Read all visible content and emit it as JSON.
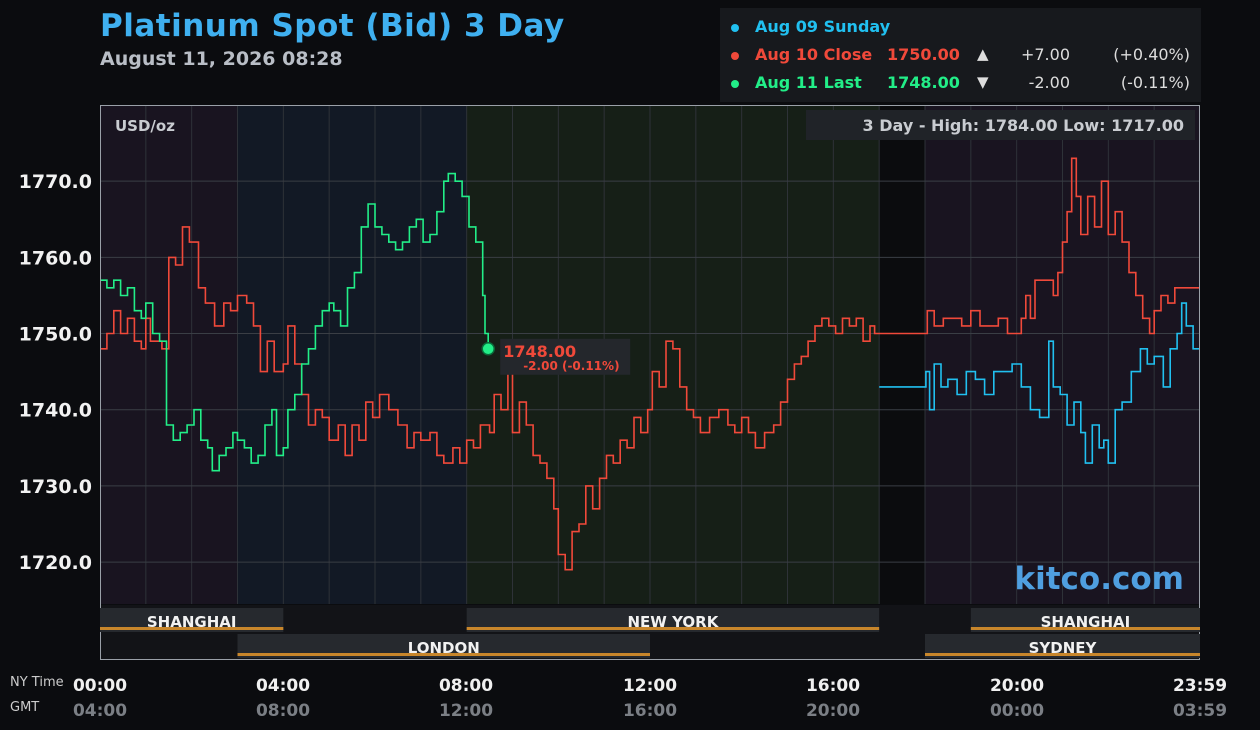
{
  "header": {
    "title": "Platinum Spot (Bid) 3 Day",
    "subtitle": "August 11, 2026 08:28"
  },
  "legend": [
    {
      "label": "Aug 09 Sunday",
      "value": "",
      "arrow": "",
      "change": "",
      "pct": "",
      "color": "#21c0f0"
    },
    {
      "label": "Aug 10 Close",
      "value": "1750.00",
      "arrow": "▲",
      "change": "+7.00",
      "pct": "(+0.40%)",
      "color": "#f0493a"
    },
    {
      "label": "Aug 11 Last",
      "value": "1748.00",
      "arrow": "▼",
      "change": "-2.00",
      "pct": "(-0.11%)",
      "color": "#22ee88"
    }
  ],
  "axis_labels": {
    "ny_time": "NY Time",
    "gmt": "GMT"
  },
  "ny_ticks": [
    "00:00",
    "04:00",
    "08:00",
    "12:00",
    "16:00",
    "20:00",
    "23:59"
  ],
  "gmt_ticks": [
    "04:00",
    "08:00",
    "12:00",
    "16:00",
    "20:00",
    "00:00",
    "03:59"
  ],
  "chart_data": {
    "type": "line",
    "unit_label": "USD/oz",
    "high_low_label": "3 Day - High: 1784.00  Low: 1717.00",
    "watermark": "kitco.com",
    "last_label": {
      "price": "1748.00",
      "change": "-2.00 (-0.11%)",
      "x": 8.47,
      "y": 1748
    },
    "x_unit": "hours (NY time)",
    "xlim": [
      0,
      24
    ],
    "ylim": [
      1714.5,
      1780.0
    ],
    "yticks": [
      1720.0,
      1730.0,
      1740.0,
      1750.0,
      1760.0,
      1770.0
    ],
    "ytick_labels": [
      "1720.0",
      "1730.0",
      "1740.0",
      "1750.0",
      "1760.0",
      "1770.0"
    ],
    "grid": true,
    "sessions": [
      {
        "name": "SHANGHAI",
        "start": 0,
        "end": 4,
        "row": 1
      },
      {
        "name": "NEW YORK",
        "start": 8,
        "end": 17,
        "row": 1
      },
      {
        "name": "SHANGHAI",
        "start": 19,
        "end": 24,
        "row": 1
      },
      {
        "name": "LONDON",
        "start": 3,
        "end": 12,
        "row": 2
      },
      {
        "name": "SYDNEY",
        "start": 18,
        "end": 24,
        "row": 2
      }
    ],
    "series": [
      {
        "name": "Aug 09 Sunday",
        "color": "#21c0f0",
        "points": [
          [
            17.0,
            1743
          ],
          [
            18.0,
            1743
          ],
          [
            18.02,
            1745
          ],
          [
            18.1,
            1740
          ],
          [
            18.2,
            1746
          ],
          [
            18.35,
            1743
          ],
          [
            18.5,
            1744
          ],
          [
            18.7,
            1742
          ],
          [
            18.9,
            1745
          ],
          [
            19.1,
            1744
          ],
          [
            19.3,
            1742
          ],
          [
            19.5,
            1745
          ],
          [
            19.7,
            1745
          ],
          [
            19.9,
            1746
          ],
          [
            20.1,
            1743
          ],
          [
            20.3,
            1740
          ],
          [
            20.5,
            1739
          ],
          [
            20.7,
            1749
          ],
          [
            20.8,
            1743
          ],
          [
            20.95,
            1742
          ],
          [
            21.1,
            1738
          ],
          [
            21.25,
            1741
          ],
          [
            21.4,
            1737
          ],
          [
            21.5,
            1733
          ],
          [
            21.65,
            1738
          ],
          [
            21.8,
            1735
          ],
          [
            21.9,
            1736
          ],
          [
            22.0,
            1733
          ],
          [
            22.15,
            1740
          ],
          [
            22.3,
            1741
          ],
          [
            22.5,
            1745
          ],
          [
            22.7,
            1748
          ],
          [
            22.85,
            1746
          ],
          [
            23.0,
            1747
          ],
          [
            23.2,
            1743
          ],
          [
            23.35,
            1748
          ],
          [
            23.5,
            1750
          ],
          [
            23.6,
            1754
          ],
          [
            23.7,
            1751
          ],
          [
            23.85,
            1748
          ],
          [
            24.0,
            1748
          ]
        ]
      },
      {
        "name": "Aug 10 Close",
        "color": "#f0493a",
        "points": [
          [
            0.0,
            1748
          ],
          [
            0.15,
            1750
          ],
          [
            0.3,
            1753
          ],
          [
            0.45,
            1750
          ],
          [
            0.6,
            1752
          ],
          [
            0.75,
            1749
          ],
          [
            0.9,
            1748
          ],
          [
            1.0,
            1752
          ],
          [
            1.1,
            1749
          ],
          [
            1.35,
            1748
          ],
          [
            1.5,
            1760
          ],
          [
            1.65,
            1759
          ],
          [
            1.8,
            1764
          ],
          [
            1.95,
            1762
          ],
          [
            2.15,
            1756
          ],
          [
            2.3,
            1754
          ],
          [
            2.5,
            1751
          ],
          [
            2.7,
            1754
          ],
          [
            2.85,
            1753
          ],
          [
            3.0,
            1755
          ],
          [
            3.2,
            1754
          ],
          [
            3.35,
            1751
          ],
          [
            3.5,
            1745
          ],
          [
            3.65,
            1749
          ],
          [
            3.8,
            1745
          ],
          [
            4.0,
            1746
          ],
          [
            4.1,
            1751
          ],
          [
            4.25,
            1746
          ],
          [
            4.4,
            1742
          ],
          [
            4.55,
            1738
          ],
          [
            4.7,
            1740
          ],
          [
            4.85,
            1739
          ],
          [
            5.0,
            1736
          ],
          [
            5.2,
            1738
          ],
          [
            5.35,
            1734
          ],
          [
            5.5,
            1738
          ],
          [
            5.65,
            1736
          ],
          [
            5.8,
            1741
          ],
          [
            5.95,
            1739
          ],
          [
            6.1,
            1742
          ],
          [
            6.3,
            1740
          ],
          [
            6.5,
            1738
          ],
          [
            6.7,
            1735
          ],
          [
            6.85,
            1737
          ],
          [
            7.0,
            1736
          ],
          [
            7.2,
            1737
          ],
          [
            7.35,
            1734
          ],
          [
            7.5,
            1733
          ],
          [
            7.7,
            1735
          ],
          [
            7.85,
            1733
          ],
          [
            8.0,
            1736
          ],
          [
            8.15,
            1735
          ],
          [
            8.3,
            1738
          ],
          [
            8.5,
            1737
          ],
          [
            8.6,
            1742
          ],
          [
            8.75,
            1740
          ],
          [
            8.9,
            1745
          ],
          [
            9.0,
            1737
          ],
          [
            9.15,
            1741
          ],
          [
            9.3,
            1738
          ],
          [
            9.45,
            1734
          ],
          [
            9.6,
            1733
          ],
          [
            9.75,
            1731
          ],
          [
            9.9,
            1727
          ],
          [
            10.0,
            1721
          ],
          [
            10.15,
            1719
          ],
          [
            10.3,
            1724
          ],
          [
            10.45,
            1725
          ],
          [
            10.6,
            1730
          ],
          [
            10.75,
            1727
          ],
          [
            10.9,
            1731
          ],
          [
            11.05,
            1734
          ],
          [
            11.2,
            1733
          ],
          [
            11.35,
            1736
          ],
          [
            11.5,
            1735
          ],
          [
            11.65,
            1739
          ],
          [
            11.8,
            1737
          ],
          [
            11.95,
            1740
          ],
          [
            12.05,
            1745
          ],
          [
            12.2,
            1743
          ],
          [
            12.35,
            1749
          ],
          [
            12.5,
            1748
          ],
          [
            12.65,
            1743
          ],
          [
            12.8,
            1740
          ],
          [
            12.95,
            1739
          ],
          [
            13.1,
            1737
          ],
          [
            13.3,
            1739
          ],
          [
            13.5,
            1740
          ],
          [
            13.7,
            1738
          ],
          [
            13.85,
            1737
          ],
          [
            14.0,
            1739
          ],
          [
            14.15,
            1737
          ],
          [
            14.3,
            1735
          ],
          [
            14.5,
            1737
          ],
          [
            14.7,
            1738
          ],
          [
            14.85,
            1741
          ],
          [
            15.0,
            1744
          ],
          [
            15.15,
            1746
          ],
          [
            15.3,
            1747
          ],
          [
            15.45,
            1749
          ],
          [
            15.6,
            1751
          ],
          [
            15.75,
            1752
          ],
          [
            15.9,
            1751
          ],
          [
            16.05,
            1750
          ],
          [
            16.2,
            1752
          ],
          [
            16.35,
            1751
          ],
          [
            16.5,
            1752
          ],
          [
            16.65,
            1749
          ],
          [
            16.8,
            1751
          ],
          [
            16.9,
            1750
          ],
          [
            17.0,
            1750
          ],
          [
            18.0,
            1750
          ],
          [
            18.05,
            1753
          ],
          [
            18.2,
            1751
          ],
          [
            18.4,
            1752
          ],
          [
            18.6,
            1752
          ],
          [
            18.8,
            1751
          ],
          [
            19.0,
            1753
          ],
          [
            19.2,
            1751
          ],
          [
            19.4,
            1751
          ],
          [
            19.6,
            1752
          ],
          [
            19.8,
            1750
          ],
          [
            20.0,
            1750
          ],
          [
            20.1,
            1752
          ],
          [
            20.2,
            1755
          ],
          [
            20.3,
            1752
          ],
          [
            20.4,
            1757
          ],
          [
            20.55,
            1757
          ],
          [
            20.7,
            1757
          ],
          [
            20.8,
            1755
          ],
          [
            20.9,
            1758
          ],
          [
            21.0,
            1762
          ],
          [
            21.1,
            1766
          ],
          [
            21.2,
            1773
          ],
          [
            21.3,
            1768
          ],
          [
            21.4,
            1763
          ],
          [
            21.55,
            1768
          ],
          [
            21.7,
            1764
          ],
          [
            21.85,
            1770
          ],
          [
            22.0,
            1763
          ],
          [
            22.15,
            1766
          ],
          [
            22.3,
            1762
          ],
          [
            22.45,
            1758
          ],
          [
            22.6,
            1755
          ],
          [
            22.75,
            1752
          ],
          [
            22.9,
            1750
          ],
          [
            23.0,
            1753
          ],
          [
            23.15,
            1755
          ],
          [
            23.3,
            1754
          ],
          [
            23.45,
            1756
          ],
          [
            23.6,
            1756
          ],
          [
            23.8,
            1756
          ],
          [
            24.0,
            1756
          ]
        ]
      },
      {
        "name": "Aug 11 Last",
        "color": "#22ee88",
        "points": [
          [
            0.0,
            1757
          ],
          [
            0.15,
            1756
          ],
          [
            0.3,
            1757
          ],
          [
            0.45,
            1755
          ],
          [
            0.6,
            1756
          ],
          [
            0.75,
            1753
          ],
          [
            0.9,
            1752
          ],
          [
            1.0,
            1754
          ],
          [
            1.15,
            1750
          ],
          [
            1.3,
            1749
          ],
          [
            1.45,
            1738
          ],
          [
            1.6,
            1736
          ],
          [
            1.75,
            1737
          ],
          [
            1.9,
            1738
          ],
          [
            2.05,
            1740
          ],
          [
            2.2,
            1736
          ],
          [
            2.35,
            1735
          ],
          [
            2.45,
            1732
          ],
          [
            2.6,
            1734
          ],
          [
            2.75,
            1735
          ],
          [
            2.9,
            1737
          ],
          [
            3.0,
            1736
          ],
          [
            3.15,
            1735
          ],
          [
            3.3,
            1733
          ],
          [
            3.45,
            1734
          ],
          [
            3.6,
            1738
          ],
          [
            3.75,
            1740
          ],
          [
            3.85,
            1734
          ],
          [
            4.0,
            1735
          ],
          [
            4.1,
            1740
          ],
          [
            4.25,
            1742
          ],
          [
            4.4,
            1746
          ],
          [
            4.55,
            1748
          ],
          [
            4.7,
            1751
          ],
          [
            4.85,
            1753
          ],
          [
            5.0,
            1754
          ],
          [
            5.1,
            1753
          ],
          [
            5.25,
            1751
          ],
          [
            5.4,
            1756
          ],
          [
            5.55,
            1758
          ],
          [
            5.7,
            1764
          ],
          [
            5.85,
            1767
          ],
          [
            6.0,
            1764
          ],
          [
            6.15,
            1763
          ],
          [
            6.3,
            1762
          ],
          [
            6.45,
            1761
          ],
          [
            6.6,
            1762
          ],
          [
            6.75,
            1764
          ],
          [
            6.9,
            1765
          ],
          [
            7.05,
            1762
          ],
          [
            7.2,
            1763
          ],
          [
            7.35,
            1766
          ],
          [
            7.5,
            1770
          ],
          [
            7.6,
            1771
          ],
          [
            7.75,
            1770
          ],
          [
            7.9,
            1768
          ],
          [
            8.05,
            1764
          ],
          [
            8.2,
            1762
          ],
          [
            8.3,
            1762
          ],
          [
            8.35,
            1755
          ],
          [
            8.4,
            1750
          ],
          [
            8.47,
            1748
          ]
        ]
      }
    ]
  }
}
